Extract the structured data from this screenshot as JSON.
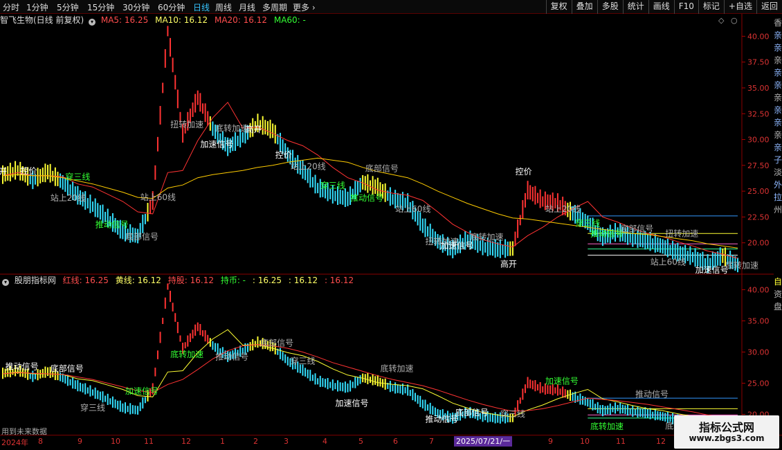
{
  "toolbar": {
    "timeframes": [
      {
        "label": "分时",
        "active": false
      },
      {
        "label": "1分钟",
        "active": false
      },
      {
        "label": "5分钟",
        "active": false
      },
      {
        "label": "15分钟",
        "active": false
      },
      {
        "label": "30分钟",
        "active": false
      },
      {
        "label": "60分钟",
        "active": false
      },
      {
        "label": "日线",
        "active": true
      },
      {
        "label": "周线",
        "active": false
      },
      {
        "label": "月线",
        "active": false
      },
      {
        "label": "多周期",
        "active": false
      },
      {
        "label": "更多 ›",
        "active": false
      }
    ],
    "right_buttons": [
      "复权",
      "叠加",
      "多股",
      "统计",
      "画线",
      "F10",
      "标记",
      "+自选",
      "返回"
    ]
  },
  "main_panel": {
    "title": "智飞生物(日线 前复权)",
    "indicators": [
      {
        "text": "MA5: 16.25",
        "color": "#ff4d4d"
      },
      {
        "text": "MA10: 16.12",
        "color": "#ffff66"
      },
      {
        "text": "MA20: 16.12",
        "color": "#ff4d4d"
      },
      {
        "text": "MA60: -",
        "color": "#33ff33"
      }
    ],
    "y_ticks": [
      "40.00",
      "37.50",
      "35.00",
      "32.50",
      "30.00",
      "27.50",
      "25.00",
      "22.50",
      "20.00"
    ]
  },
  "sub_panel": {
    "title": "股朋指标网",
    "indicators": [
      {
        "text": "红线: 16.25",
        "color": "#ff4d4d"
      },
      {
        "text": "黄线: 16.12",
        "color": "#ffff66"
      },
      {
        "text": "持股: 16.12",
        "color": "#ff4d4d"
      },
      {
        "text": "持币: -",
        "color": "#33ff33"
      },
      {
        "text": ": 16.25",
        "color": "#ffff66"
      },
      {
        "text": ": 16.12",
        "color": "#ffff66"
      },
      {
        "text": ": 16.12",
        "color": "#ff4d4d"
      }
    ],
    "y_ticks": [
      "40.00",
      "35.00",
      "30.00",
      "25.00",
      "20.00"
    ]
  },
  "right_strip": {
    "top_chars": [
      "香",
      "亲",
      "亲",
      "亲",
      "亲",
      "亲",
      "亲",
      "亲",
      "亲",
      "亲",
      "亲",
      "子",
      "淡",
      "外",
      "拉",
      "州"
    ],
    "bottom_chars": [
      "自",
      "资",
      "盘"
    ]
  },
  "future_note": "用到未来数据",
  "x_axis": {
    "ticks": [
      "2024年",
      "8",
      "9",
      "10",
      "11",
      "12",
      "1",
      "2",
      "3",
      "4",
      "5",
      "6",
      "7",
      "8",
      "9",
      "10",
      "11",
      "12",
      "1"
    ],
    "current_date": "2025/07/21/一"
  },
  "watermark": {
    "title": "指标公式网",
    "url": "www.zbgs3.com"
  },
  "chart_data": [
    {
      "type": "line",
      "title": "智飞生物(日线 前复权)",
      "ylim": [
        17.5,
        41.5
      ],
      "y_ticks": [
        40,
        37.5,
        35,
        32.5,
        30,
        27.5,
        25,
        22.5,
        20
      ],
      "x_ticks": [
        "2024年",
        "8",
        "9",
        "10",
        "11",
        "12",
        "1",
        "2",
        "3",
        "4",
        "5",
        "6",
        "7",
        "8",
        "9",
        "10",
        "11",
        "12",
        "1"
      ],
      "series": [
        {
          "name": "price",
          "values": [
            26.5,
            27.0,
            26.0,
            26.8,
            25.8,
            24.5,
            23.5,
            22.3,
            21.0,
            20.6,
            24.0,
            40.5,
            30.5,
            34.0,
            31.0,
            29.2,
            30.2,
            31.5,
            30.8,
            28.5,
            27.0,
            25.3,
            24.6,
            24.2,
            25.8,
            25.3,
            24.2,
            23.8,
            21.6,
            20.1,
            19.3,
            20.3,
            19.6,
            19.3,
            19.4,
            25.0,
            24.0,
            23.8,
            22.8,
            21.9,
            20.5,
            21.0,
            20.4,
            20.1,
            19.6,
            19.0,
            18.6,
            17.9,
            18.7,
            17.8
          ]
        },
        {
          "name": "MA5",
          "values": [
            26.5,
            26.8,
            26.5,
            26.5,
            26.4,
            25.7,
            25.4,
            24.7,
            24.0,
            23.0,
            22.8,
            26.8,
            27.0,
            29.9,
            32.1,
            33.6,
            31.1,
            31.2,
            30.6,
            29.9,
            29.4,
            28.5,
            27.3,
            26.3,
            25.8,
            25.1,
            24.8,
            24.6,
            24.1,
            23.0,
            21.8,
            21.0,
            20.3,
            19.9,
            19.6,
            20.7,
            21.5,
            22.5,
            23.3,
            24.0,
            22.5,
            22.0,
            21.4,
            20.9,
            20.6,
            20.1,
            19.7,
            19.2,
            18.9,
            18.5
          ]
        },
        {
          "name": "MA20",
          "values": [
            26.5,
            26.6,
            26.5,
            26.5,
            26.3,
            26.0,
            25.7,
            25.3,
            24.9,
            24.4,
            24.3,
            25.3,
            25.6,
            26.3,
            26.6,
            26.8,
            27.0,
            27.3,
            27.5,
            27.8,
            28.0,
            28.2,
            28.0,
            27.8,
            27.3,
            26.9,
            26.6,
            26.3,
            25.7,
            25.0,
            24.4,
            23.8,
            23.3,
            22.8,
            22.4,
            22.3,
            22.1,
            21.9,
            21.7,
            21.5,
            21.3,
            21.1,
            20.9,
            20.8,
            20.6,
            20.4,
            20.2,
            19.9,
            19.7,
            19.5
          ]
        }
      ],
      "annotations": [
        "高开",
        "控价",
        "站上20线",
        "穿三线",
        "推动信号",
        "底部信号",
        "站上60线",
        "扭转加速",
        "加速信号",
        "底转加速"
      ],
      "levels": [
        22.6,
        20.9,
        19.9,
        19.4,
        18.8
      ]
    },
    {
      "type": "line",
      "title": "股朋指标网",
      "ylim": [
        18.5,
        41.5
      ],
      "y_ticks": [
        40,
        35,
        30,
        25,
        20
      ],
      "series": [
        {
          "name": "红线",
          "values": [
            26.5,
            26.8,
            26.5,
            26.5,
            26.4,
            25.7,
            25.4,
            24.7,
            24.0,
            23.0,
            22.8,
            26.8,
            27.0,
            29.9,
            32.1,
            33.6,
            31.1,
            31.2,
            30.6,
            29.9,
            29.4,
            28.5,
            27.3,
            26.3,
            25.8,
            25.1,
            24.8,
            24.6,
            24.1,
            23.0,
            21.8,
            21.0,
            20.3,
            19.9,
            19.6,
            20.7,
            21.5,
            22.5,
            23.3,
            24.0,
            22.5,
            22.0,
            21.4,
            20.9,
            20.6,
            20.1,
            19.7,
            19.2,
            18.9,
            18.5
          ]
        },
        {
          "name": "黄线",
          "values": [
            26.5,
            26.7,
            26.6,
            26.5,
            26.4,
            26.0,
            25.6,
            25.0,
            24.4,
            23.8,
            23.5,
            24.8,
            25.6,
            27.2,
            28.9,
            30.2,
            31.0,
            31.2,
            31.0,
            30.6,
            30.0,
            29.2,
            28.3,
            27.6,
            26.9,
            26.2,
            25.6,
            25.1,
            24.6,
            23.9,
            23.1,
            22.3,
            21.6,
            21.0,
            20.5,
            20.6,
            20.9,
            21.4,
            22.0,
            22.6,
            22.4,
            22.2,
            21.9,
            21.6,
            21.2,
            20.8,
            20.4,
            19.9,
            19.5,
            19.0
          ]
        }
      ],
      "annotations": [
        "推动信号",
        "底部信号",
        "穿三线",
        "加速信号",
        "底转加速"
      ],
      "levels": [
        22.6,
        20.9,
        19.9,
        19.4
      ]
    }
  ]
}
